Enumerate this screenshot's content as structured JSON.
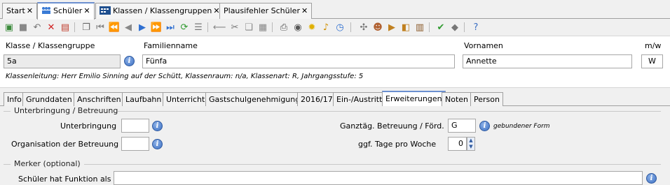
{
  "top_tabs": [
    {
      "label": "Start"
    },
    {
      "label": "Schüler"
    },
    {
      "label": "Klassen / Klassengruppen"
    },
    {
      "label": "Plausifehler Schüler"
    }
  ],
  "toolbar": {
    "icons": [
      "new-record-icon",
      "save-icon",
      "undo-icon",
      "delete-icon",
      "cancel-icon",
      "copy-icon",
      "first-record-icon",
      "prev-page-icon",
      "prev-record-icon",
      "next-record-icon",
      "next-page-icon",
      "last-record-icon",
      "refresh-icon",
      "list-icon",
      "back-arrow-icon",
      "cut-icon",
      "paste-icon",
      "print-icon",
      "preview-icon",
      "lightbulb-icon",
      "bell-icon",
      "clock-icon",
      "network-icon",
      "user-icon",
      "export-icon",
      "import-icon",
      "report-icon",
      "check-icon",
      "erase-icon",
      "help-icon"
    ]
  },
  "header": {
    "klasse_label": "Klasse / Klassengruppe",
    "klasse_value": "5a",
    "familienname_label": "Familienname",
    "familienname_value": "Fünfa",
    "vornamen_label": "Vornamen",
    "vornamen_value": "Annette",
    "mw_label": "m/w",
    "mw_value": "W",
    "info_line": "Klassenleitung: Herr Emilio Sinning auf der Schütt, Klassenraum: n/a, Klassenart: R, Jahrgangsstufe: 5"
  },
  "inner_tabs": [
    {
      "label": "Info"
    },
    {
      "label": "Grunddaten"
    },
    {
      "label": "Anschriften"
    },
    {
      "label": "Laufbahn"
    },
    {
      "label": "Unterricht"
    },
    {
      "label": "Gastschulgenehmigung"
    },
    {
      "label": "2016/17"
    },
    {
      "label": "Ein-/Austritt"
    },
    {
      "label": "Erweiterungen"
    },
    {
      "label": "Noten"
    },
    {
      "label": "Person"
    }
  ],
  "unterbringung": {
    "section_title": "Unterbringung / Betreuung",
    "unterbringung_label": "Unterbringung",
    "unterbringung_value": "",
    "organisation_label": "Organisation der Betreuung",
    "organisation_value": "",
    "ganztag_label": "Ganztäg. Betreuung / Förd.",
    "ganztag_value": "G",
    "ganztag_hint": "gebundener Form",
    "tage_label": "ggf. Tage pro Woche",
    "tage_value": "0"
  },
  "merker": {
    "section_title": "Merker (optional)",
    "funktion_label": "Schüler hat Funktion als",
    "funktion_value": ""
  },
  "colors": {
    "active_tab_accent": "#6b8fd0",
    "info_icon": "#3b6fc3",
    "readonly_field": "#ebebeb"
  }
}
